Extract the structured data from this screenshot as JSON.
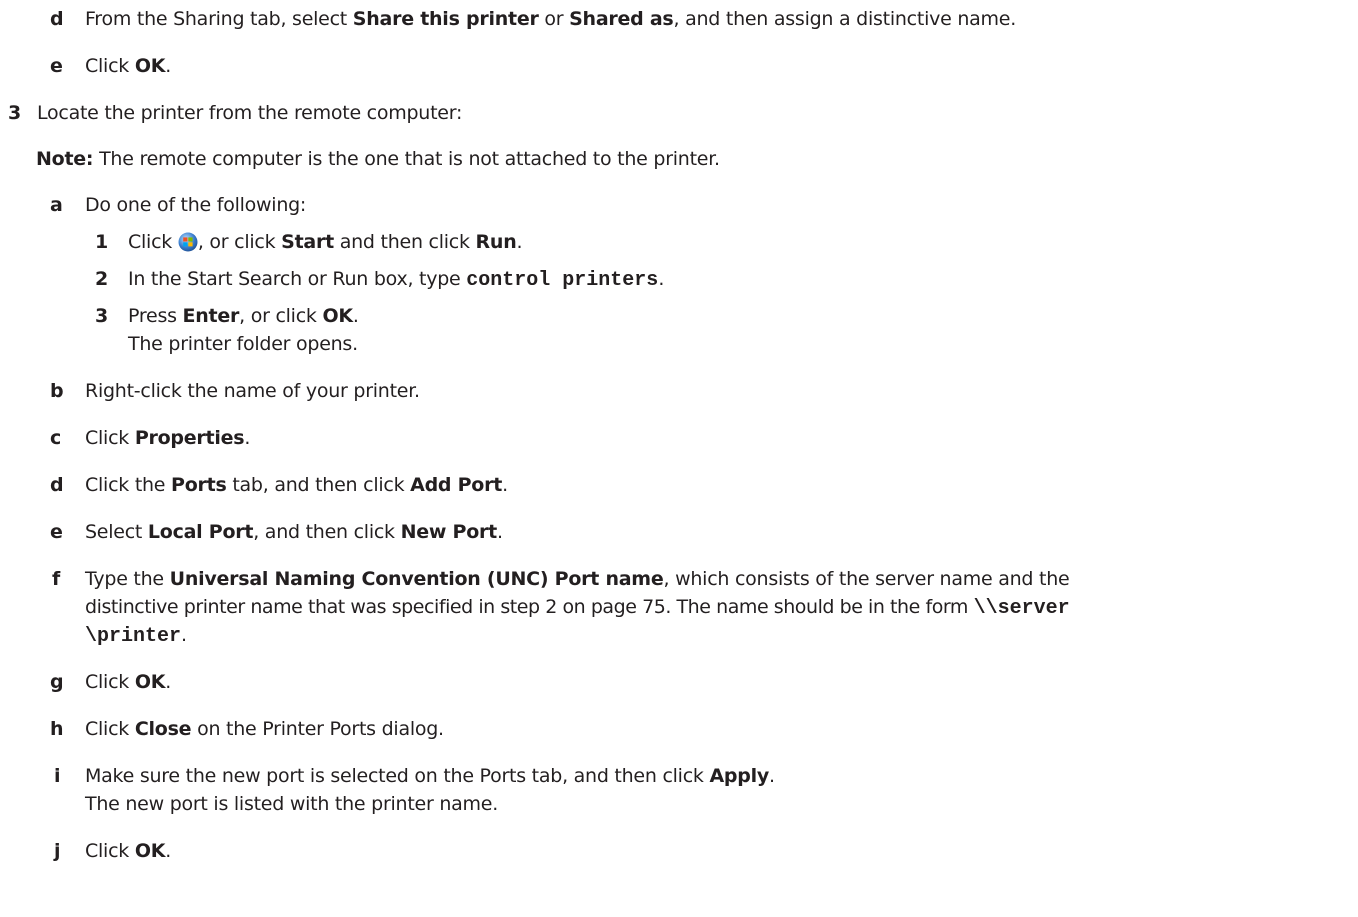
{
  "d1": {
    "letter": "d",
    "p1": "From the Sharing tab, select ",
    "b1": "Share this printer",
    "p2": " or ",
    "b2": "Shared as",
    "p3": ", and then assign a distinctive name."
  },
  "e1": {
    "letter": "e",
    "p1": "Click ",
    "b1": "OK",
    "p2": "."
  },
  "s3": {
    "number": "3",
    "text": "Locate the printer from the remote computer:"
  },
  "note": {
    "label": "Note:",
    "text": " The remote computer is the one that is not attached to the printer."
  },
  "a": {
    "letter": "a",
    "text": "Do one of the following:"
  },
  "a1": {
    "number": "1",
    "p1": "Click ",
    "p2": ", or click ",
    "b1": "Start",
    "p3": " and then click ",
    "b2": "Run",
    "p4": ".",
    "icon": "windows-start-orb-icon"
  },
  "a2": {
    "number": "2",
    "p1": "In the Start Search or Run box, type ",
    "code": "control printers",
    "p2": "."
  },
  "a3": {
    "number": "3",
    "p1": "Press ",
    "b1": "Enter",
    "p2": ", or click ",
    "b2": "OK",
    "p3": ".",
    "line2": "The printer folder opens."
  },
  "b": {
    "letter": "b",
    "text": "Right-click the name of your printer."
  },
  "c": {
    "letter": "c",
    "p1": "Click ",
    "b1": "Properties",
    "p2": "."
  },
  "d2": {
    "letter": "d",
    "p1": "Click the ",
    "b1": "Ports",
    "p2": " tab, and then click ",
    "b2": "Add Port",
    "p3": "."
  },
  "e2": {
    "letter": "e",
    "p1": "Select ",
    "b1": "Local Port",
    "p2": ", and then click ",
    "b2": "New Port",
    "p3": "."
  },
  "f": {
    "letter": "f",
    "p1": "Type the ",
    "b1": "Universal Naming Convention (UNC) Port name",
    "p2": ", which consists of the server name and the",
    "line2": "distinctive printer name that was specified in step 2 on page 75. The name should be in the form ",
    "code1": "\\\\server",
    "code2": "\\printer",
    "p3": "."
  },
  "g": {
    "letter": "g",
    "p1": "Click ",
    "b1": "OK",
    "p2": "."
  },
  "h": {
    "letter": "h",
    "p1": "Click ",
    "b1": "Close",
    "p2": " on the Printer Ports dialog."
  },
  "i": {
    "letter": "i",
    "p1": "Make sure the new port is selected on the Ports tab, and then click ",
    "b1": "Apply",
    "p2": ".",
    "line2": "The new port is listed with the printer name."
  },
  "j": {
    "letter": "j",
    "p1": "Click ",
    "b1": "OK",
    "p2": "."
  }
}
